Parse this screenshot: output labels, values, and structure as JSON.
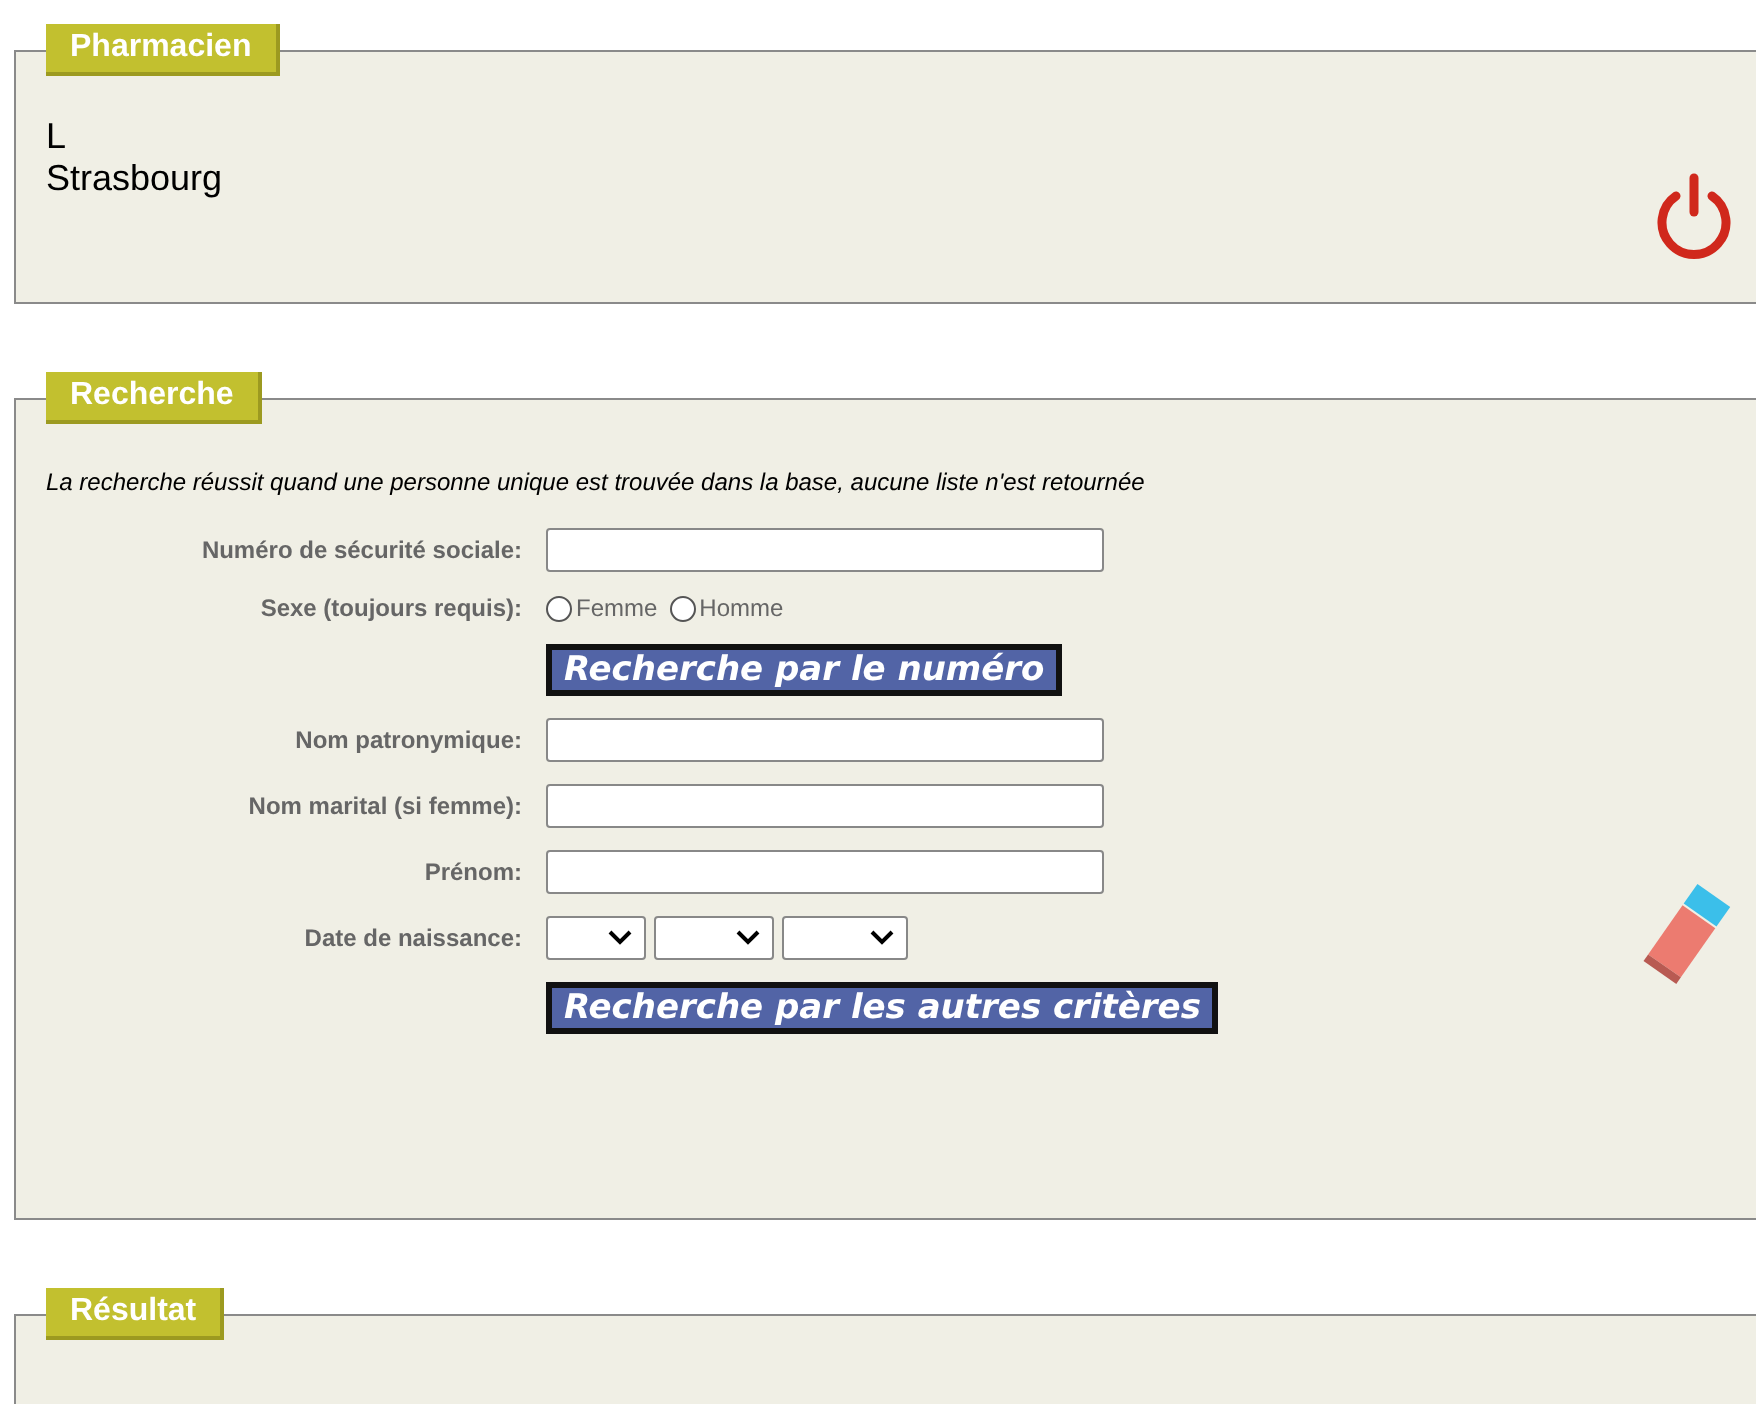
{
  "pharmacien": {
    "title": "Pharmacien",
    "lines": [
      "L",
      "Strasbourg"
    ]
  },
  "recherche": {
    "title": "Recherche",
    "note": "La recherche réussit quand une personne unique est trouvée dans la base, aucune liste n'est retournée",
    "rows": [
      {
        "kind": "text",
        "label": "Numéro de sécurité sociale:"
      },
      {
        "kind": "radio",
        "label": "Sexe (toujours requis):",
        "options": [
          {
            "label": "Femme",
            "selected": false
          },
          {
            "label": "Homme",
            "selected": false
          }
        ]
      },
      {
        "kind": "button",
        "label": "Recherche par le numéro"
      },
      {
        "kind": "text",
        "label": "Nom patronymique:"
      },
      {
        "kind": "text",
        "label": "Nom marital (si femme):"
      },
      {
        "kind": "text",
        "label": "Prénom:"
      },
      {
        "kind": "date",
        "label": "Date de naissance:"
      },
      {
        "kind": "button",
        "label": "Recherche par les autres critères"
      }
    ]
  },
  "resultat": {
    "title": "Résultat"
  }
}
